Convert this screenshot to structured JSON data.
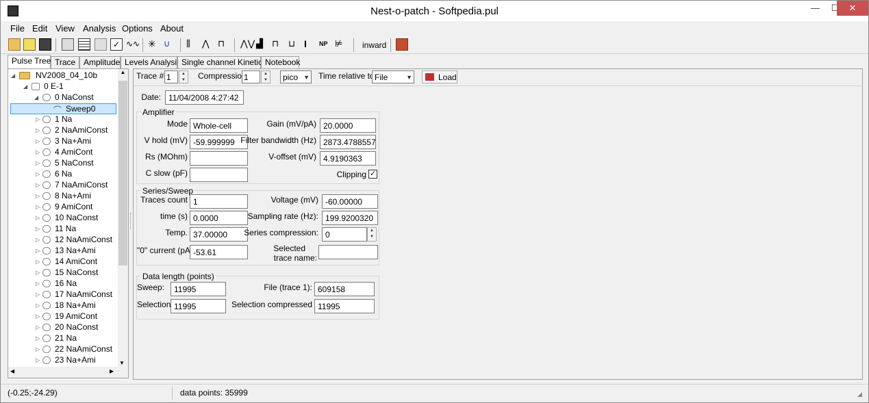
{
  "window": {
    "title": "Nest-o-patch - Softpedia.pul",
    "minimize": "—",
    "maximize": "☐",
    "close": "✕"
  },
  "menu": [
    "File",
    "Edit",
    "View",
    "Analysis",
    "Options",
    "About"
  ],
  "toolbar": {
    "direction_label": "inward"
  },
  "tabs": [
    "Pulse Tree",
    "Trace",
    "Amplitude",
    "Levels Analysis",
    "Single channel Kinetics",
    "Notebook"
  ],
  "tree": {
    "root": "NV2008_04_10b",
    "group": "0 E-1",
    "series_expanded": "0 NaConst",
    "sweep": "Sweep0",
    "series": [
      "1 Na",
      "2 NaAmiConst",
      "3 Na+Ami",
      "4 AmiCont",
      "5 NaConst",
      "6 Na",
      "7 NaAmiConst",
      "8 Na+Ami",
      "9 AmiCont",
      "10 NaConst",
      "11 Na",
      "12 NaAmiConst",
      "13 Na+Ami",
      "14 AmiCont",
      "15 NaConst",
      "16 Na",
      "17 NaAmiConst",
      "18 Na+Ami",
      "19 AmiCont",
      "20 NaConst",
      "21 Na",
      "22 NaAmiConst",
      "23 Na+Ami"
    ]
  },
  "controls": {
    "trace_label": "Trace #",
    "trace_value": "1",
    "compression_label": "Compression:",
    "compression_value": "1",
    "unit_value": "pico",
    "time_relative_label": "Time relative to:",
    "time_relative_value": "File",
    "load_label": "Load"
  },
  "date": {
    "label": "Date:",
    "value": "11/04/2008 4:27:42"
  },
  "amplifier": {
    "title": "Amplifier",
    "mode_label": "Mode",
    "mode_value": "Whole-cell",
    "vhold_label": "V hold (mV)",
    "vhold_value": "-59.999999",
    "rs_label": "Rs (MOhm)",
    "rs_value": "",
    "cslow_label": "C slow (pF)",
    "cslow_value": "",
    "gain_label": "Gain (mV/pA)",
    "gain_value": "20.0000",
    "filter_label": "Filter bandwidth (Hz)",
    "filter_value": "2873.4788557",
    "voffset_label": "V-offset (mV)",
    "voffset_value": "4.9190363",
    "clipping_label": "Clipping",
    "clipping_checked": "✓"
  },
  "series_sweep": {
    "title": "Series/Sweep",
    "traces_label": "Traces count",
    "traces_value": "1",
    "time_label": "time (s)",
    "time_value": "0.0000",
    "temp_label": "Temp.",
    "temp_value": "37.00000",
    "zero_current_label": "\"0\" current (pA)",
    "zero_current_value": "-53.61",
    "voltage_label": "Voltage (mV)",
    "voltage_value": "-60.00000",
    "sampling_label": "Sampling rate (Hz):",
    "sampling_value": "199.9200320",
    "series_comp_label": "Series compression:",
    "series_comp_value": "0",
    "selected_trace_label_1": "Selected",
    "selected_trace_label_2": "trace name:",
    "selected_trace_value": ""
  },
  "data_length": {
    "title": "Data length (points)",
    "sweep_label": "Sweep:",
    "sweep_value": "11995",
    "selection_label": "Selection",
    "selection_value": "11995",
    "file_label": "File (trace 1):",
    "file_value": "609158",
    "selection_comp_label": "Selection compressed",
    "selection_comp_value": "11995"
  },
  "status": {
    "coords": "(-0.25;-24.29)",
    "data_points": "data points: 35999"
  }
}
